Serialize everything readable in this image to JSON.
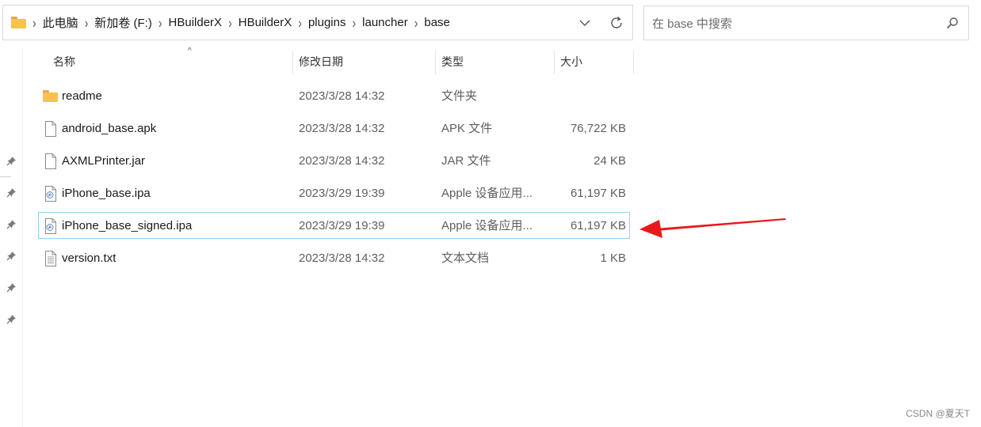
{
  "address_bar": {
    "breadcrumbs": [
      "此电脑",
      "新加卷 (F:)",
      "HBuilderX",
      "HBuilderX",
      "plugins",
      "launcher",
      "base"
    ]
  },
  "search": {
    "placeholder": "在 base 中搜索"
  },
  "columns": {
    "name": "名称",
    "date": "修改日期",
    "type": "类型",
    "size": "大小"
  },
  "files": [
    {
      "name": "readme",
      "date": "2023/3/28 14:32",
      "type": "文件夹",
      "size": "",
      "icon": "folder-icon"
    },
    {
      "name": "android_base.apk",
      "date": "2023/3/28 14:32",
      "type": "APK 文件",
      "size": "76,722 KB",
      "icon": "file-icon"
    },
    {
      "name": "AXMLPrinter.jar",
      "date": "2023/3/28 14:32",
      "type": "JAR 文件",
      "size": "24 KB",
      "icon": "file-icon"
    },
    {
      "name": "iPhone_base.ipa",
      "date": "2023/3/29 19:39",
      "type": "Apple 设备应用...",
      "size": "61,197 KB",
      "icon": "ipa-icon"
    },
    {
      "name": "iPhone_base_signed.ipa",
      "date": "2023/3/29 19:39",
      "type": "Apple 设备应用...",
      "size": "61,197 KB",
      "icon": "ipa-icon"
    },
    {
      "name": "version.txt",
      "date": "2023/3/28 14:32",
      "type": "文本文档",
      "size": "1 KB",
      "icon": "text-file-icon"
    }
  ],
  "selected_index": 4,
  "annotation": {
    "color": "#e8191b",
    "points_to": "iPhone_base_signed.ipa"
  },
  "watermark": "CSDN @夏天T"
}
